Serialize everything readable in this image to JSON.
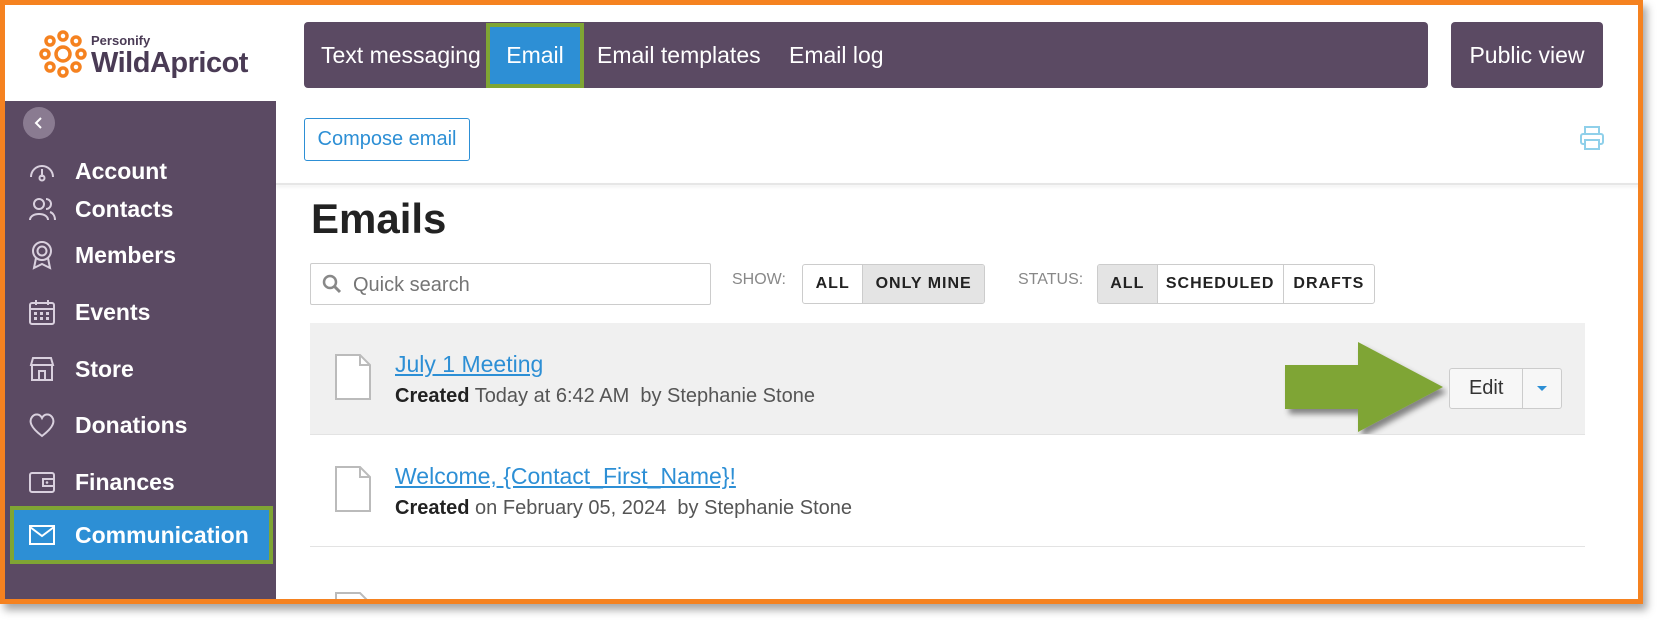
{
  "logo": {
    "small": "Personify",
    "big": "WildApricot"
  },
  "colors": {
    "accent": "#2d8fd5",
    "sidebar": "#5b4a63",
    "highlight": "#7fa534",
    "frame": "#f58220",
    "arrow": "#7fa534"
  },
  "sidebar": {
    "collapse_icon": "chevron-left-icon",
    "items": [
      {
        "label": "Account",
        "icon": "gauge-icon"
      },
      {
        "label": "Contacts",
        "icon": "people-icon"
      },
      {
        "label": "Members",
        "icon": "badge-icon"
      },
      {
        "label": "Events",
        "icon": "calendar-icon"
      },
      {
        "label": "Store",
        "icon": "store-icon"
      },
      {
        "label": "Donations",
        "icon": "heart-icon"
      },
      {
        "label": "Finances",
        "icon": "wallet-icon"
      },
      {
        "label": "Communication",
        "icon": "envelope-icon",
        "active": true
      }
    ]
  },
  "tabs": [
    {
      "label": "Text messaging"
    },
    {
      "label": "Email",
      "active": true
    },
    {
      "label": "Email templates"
    },
    {
      "label": "Email log"
    }
  ],
  "public_view": "Public view",
  "compose_label": "Compose email",
  "page_title": "Emails",
  "search": {
    "placeholder": "Quick search"
  },
  "filters": {
    "show_label": "SHOW:",
    "show_options": [
      "ALL",
      "ONLY MINE"
    ],
    "show_selected": "ONLY MINE",
    "status_label": "STATUS:",
    "status_options": [
      "ALL",
      "SCHEDULED",
      "DRAFTS"
    ],
    "status_selected": "ALL"
  },
  "emails": [
    {
      "title": "July 1 Meeting",
      "created_label": "Created",
      "when": "Today at 6:42 AM",
      "by": "by Stephanie Stone"
    },
    {
      "title": "Welcome, {Contact_First_Name}!",
      "created_label": "Created",
      "when": "on February 05, 2024",
      "by": "by Stephanie Stone"
    }
  ],
  "edit_label": "Edit"
}
